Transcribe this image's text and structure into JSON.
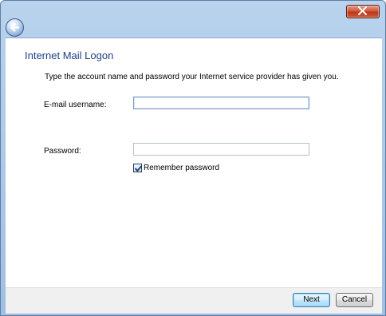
{
  "window": {
    "close_icon": "close-icon",
    "back_icon": "back-arrow-icon"
  },
  "page": {
    "title": "Internet Mail Logon",
    "instructions": "Type the account name and password your Internet service provider has given you."
  },
  "form": {
    "email_label": "E-mail username:",
    "email_value": "",
    "password_label": "Password:",
    "password_value": "",
    "remember_label": "Remember password",
    "remember_checked": true
  },
  "footer": {
    "next_label": "Next",
    "cancel_label": "Cancel"
  },
  "colors": {
    "title_text": "#1f3f8a",
    "frame": "#b9d3ee",
    "close_button": "#c8492a"
  }
}
